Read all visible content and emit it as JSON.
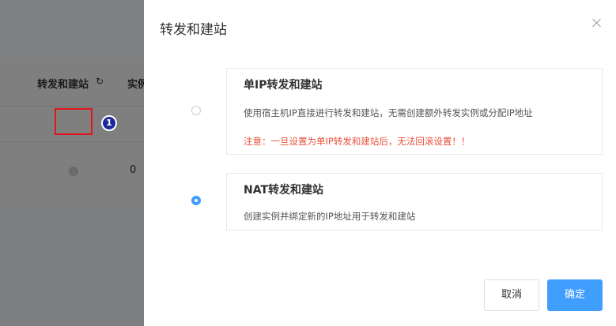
{
  "background": {
    "column_label": "转发和建站",
    "refresh_icon": "refresh-icon",
    "next_column_label": "实例",
    "row_value": "0",
    "step_badge": "1"
  },
  "dialog": {
    "title": "转发和建站",
    "close_icon": "close-icon",
    "options": [
      {
        "title": "单IP转发和建站",
        "description": "使用宿主机IP直接进行转发和建站，无需创建额外转发实例或分配IP地址",
        "warning": "注意：一旦设置为单IP转发和建站后，无法回滚设置！！",
        "selected": false
      },
      {
        "title": "NAT转发和建站",
        "description": "创建实例并绑定新的IP地址用于转发和建站",
        "selected": true
      }
    ],
    "buttons": {
      "cancel": "取消",
      "confirm": "确定"
    }
  },
  "colors": {
    "accent": "#409eff",
    "warning": "#e8503a",
    "highlight": "#e0161c",
    "badge": "#1a2a9e"
  }
}
